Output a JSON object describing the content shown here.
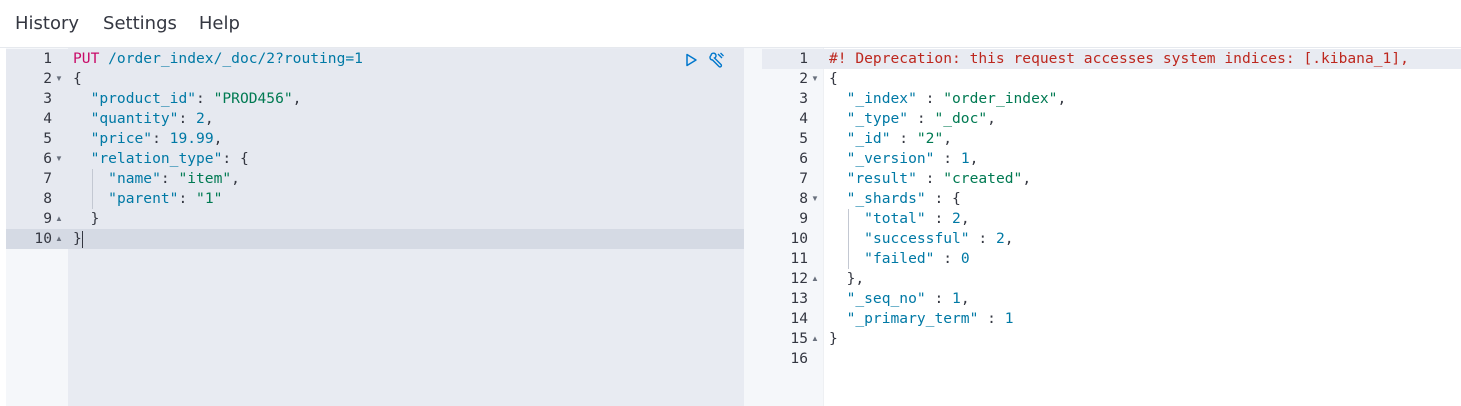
{
  "menu": {
    "history": "History",
    "settings": "Settings",
    "help": "Help"
  },
  "request": {
    "method": "PUT",
    "path": " /order_index/_doc/2?routing=1",
    "lines": [
      {
        "n": "1",
        "fold": ""
      },
      {
        "n": "2",
        "fold": "down"
      },
      {
        "n": "3",
        "fold": ""
      },
      {
        "n": "4",
        "fold": ""
      },
      {
        "n": "5",
        "fold": ""
      },
      {
        "n": "6",
        "fold": "down"
      },
      {
        "n": "7",
        "fold": ""
      },
      {
        "n": "8",
        "fold": ""
      },
      {
        "n": "9",
        "fold": "up"
      },
      {
        "n": "10",
        "fold": "up"
      }
    ],
    "body": {
      "open": "{",
      "product_id_key": "\"product_id\"",
      "product_id_val": "\"PROD456\"",
      "quantity_key": "\"quantity\"",
      "quantity_val": "2",
      "price_key": "\"price\"",
      "price_val": "19.99",
      "relation_type_key": "\"relation_type\"",
      "name_key": "\"name\"",
      "name_val": "\"item\"",
      "parent_key": "\"parent\"",
      "parent_val": "\"1\"",
      "inner_close": "}",
      "close": "}"
    }
  },
  "response": {
    "lines": [
      {
        "n": "1",
        "fold": ""
      },
      {
        "n": "2",
        "fold": "down"
      },
      {
        "n": "3",
        "fold": ""
      },
      {
        "n": "4",
        "fold": ""
      },
      {
        "n": "5",
        "fold": ""
      },
      {
        "n": "6",
        "fold": ""
      },
      {
        "n": "7",
        "fold": ""
      },
      {
        "n": "8",
        "fold": "down"
      },
      {
        "n": "9",
        "fold": ""
      },
      {
        "n": "10",
        "fold": ""
      },
      {
        "n": "11",
        "fold": ""
      },
      {
        "n": "12",
        "fold": "up"
      },
      {
        "n": "13",
        "fold": ""
      },
      {
        "n": "14",
        "fold": ""
      },
      {
        "n": "15",
        "fold": "up"
      },
      {
        "n": "16",
        "fold": ""
      }
    ],
    "warning": "#! Deprecation: this request accesses system indices: [.kibana_1],",
    "body": {
      "open": "{",
      "index_key": "\"_index\"",
      "index_val": "\"order_index\"",
      "type_key": "\"_type\"",
      "type_val": "\"_doc\"",
      "id_key": "\"_id\"",
      "id_val": "\"2\"",
      "version_key": "\"_version\"",
      "version_val": "1",
      "result_key": "\"result\"",
      "result_val": "\"created\"",
      "shards_key": "\"_shards\"",
      "total_key": "\"total\"",
      "total_val": "2",
      "successful_key": "\"successful\"",
      "successful_val": "2",
      "failed_key": "\"failed\"",
      "failed_val": "0",
      "shards_close": "},",
      "seq_no_key": "\"_seq_no\"",
      "seq_no_val": "1",
      "primary_term_key": "\"_primary_term\"",
      "primary_term_val": "1",
      "close": "}"
    }
  }
}
